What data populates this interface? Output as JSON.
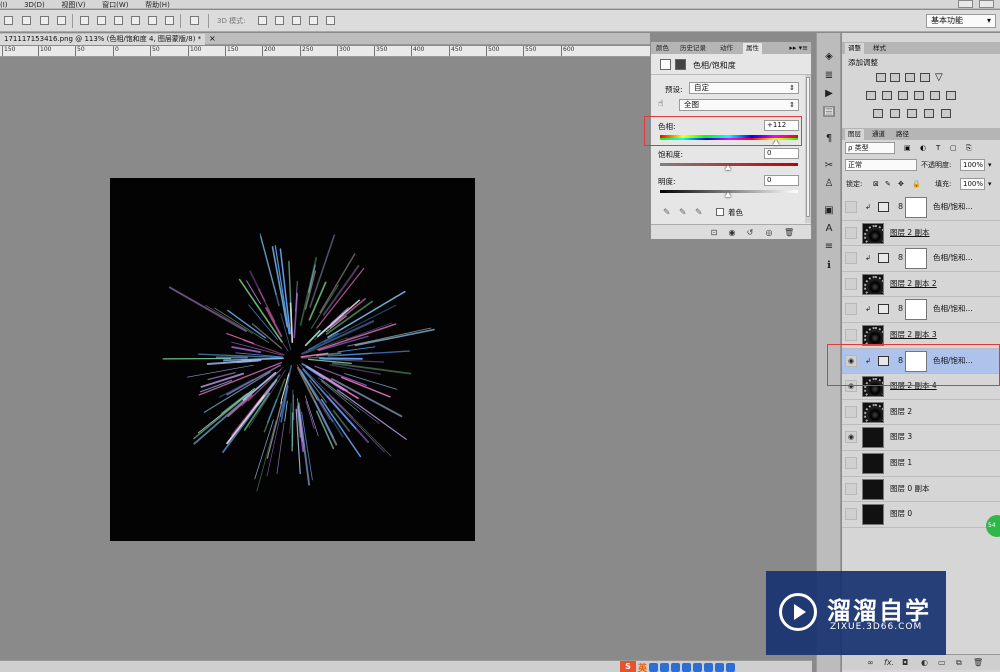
{
  "menubar": {
    "items": [
      "(I)",
      "3D(D)",
      "视图(V)",
      "窗口(W)",
      "帮助(H)"
    ]
  },
  "optbar": {
    "mode3d_label": "3D 模式:",
    "workspace": "基本功能"
  },
  "document": {
    "tab_label": "171117153416.png @ 113% (色相/饱和度 4, 图层蒙版/8) *",
    "close": "×"
  },
  "ruler": {
    "ticks": [
      "150",
      "100",
      "50",
      "0",
      "50",
      "100",
      "150",
      "200",
      "250",
      "300",
      "350",
      "400",
      "450",
      "500",
      "550",
      "600"
    ]
  },
  "properties": {
    "tabs": [
      "颜色",
      "历史记录",
      "动作",
      "属性"
    ],
    "active_tab": "属性",
    "title": "色相/饱和度",
    "preset_label": "预设:",
    "preset_value": "自定",
    "channel_value": "全图",
    "hue_label": "色相:",
    "hue_value": "+112",
    "saturation_label": "饱和度:",
    "saturation_value": "0",
    "lightness_label": "明度:",
    "lightness_value": "0",
    "colorize_label": "着色"
  },
  "adjustments": {
    "tabs": [
      "调整",
      "样式"
    ],
    "title": "添加调整"
  },
  "layers_panel": {
    "tabs": [
      "图层",
      "通道",
      "路径"
    ],
    "filter_value": "ρ 类型",
    "blend_mode": "正常",
    "opacity_label": "不透明度:",
    "opacity_value": "100%",
    "lock_label": "锁定:",
    "fill_label": "填充:",
    "fill_value": "100%",
    "layers": [
      {
        "name": "色相/饱和...",
        "type": "adjustment",
        "visible": false,
        "selected": false,
        "underline": false
      },
      {
        "name": "图层 2 副本",
        "type": "burst",
        "visible": false,
        "selected": false,
        "underline": true
      },
      {
        "name": "色相/饱和...",
        "type": "adjustment",
        "visible": false,
        "selected": false,
        "underline": false
      },
      {
        "name": "图层 2 副本 2",
        "type": "burst",
        "visible": false,
        "selected": false,
        "underline": true
      },
      {
        "name": "色相/饱和...",
        "type": "adjustment",
        "visible": false,
        "selected": false,
        "underline": false
      },
      {
        "name": "图层 2 副本 3",
        "type": "burst",
        "visible": false,
        "selected": false,
        "underline": true
      },
      {
        "name": "色相/饱和...",
        "type": "adjustment",
        "visible": true,
        "selected": true,
        "underline": false
      },
      {
        "name": "图层 2 副本 4",
        "type": "burst",
        "visible": true,
        "selected": false,
        "underline": true
      },
      {
        "name": "图层 2",
        "type": "burst",
        "visible": false,
        "selected": false,
        "underline": false
      },
      {
        "name": "图层 3",
        "type": "black",
        "visible": true,
        "selected": false,
        "underline": false
      },
      {
        "name": "图层 1",
        "type": "black",
        "visible": false,
        "selected": false,
        "underline": false
      },
      {
        "name": "图层 0 副本",
        "type": "black",
        "visible": false,
        "selected": false,
        "underline": false
      },
      {
        "name": "图层 0",
        "type": "black",
        "visible": false,
        "selected": false,
        "underline": false
      }
    ]
  },
  "statusbar": {
    "ime_logo": "S",
    "ime_lang": "英"
  },
  "watermark": {
    "title": "溜溜自学",
    "url": "ZIXUE.3D66.COM"
  },
  "badge": "54"
}
